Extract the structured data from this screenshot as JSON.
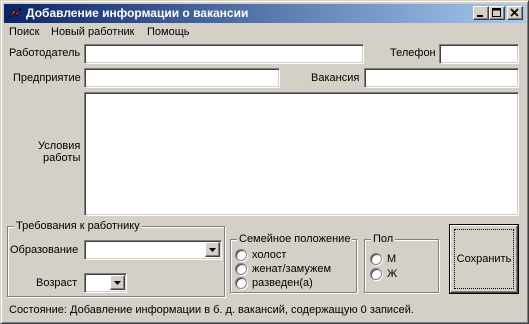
{
  "window": {
    "title": "Добавление информации о вакансии"
  },
  "menu": {
    "items": [
      "Поиск",
      "Новый работник",
      "Помощь"
    ]
  },
  "fields": {
    "employer_label": "Работодатель",
    "employer_value": "",
    "phone_label": "Телефон",
    "phone_value": "",
    "company_label": "Предприятие",
    "company_value": "",
    "vacancy_label": "Вакансия",
    "vacancy_value": "",
    "conditions_label_line1": "Условия",
    "conditions_label_line2": "работы",
    "conditions_value": ""
  },
  "requirements": {
    "title": "Требования к работнику",
    "education_label": "Образование",
    "education_value": "",
    "age_label": "Возраст",
    "age_value": ""
  },
  "marital": {
    "title": "Семейное положение",
    "options": [
      "холост",
      "женат/замужем",
      "разведен(а)"
    ]
  },
  "gender": {
    "title": "Пол",
    "options": [
      "М",
      "Ж"
    ]
  },
  "actions": {
    "save_label": "Сохранить"
  },
  "status": {
    "text": "Состояние: Добавление информации в б. д. вакансий, содержащую 0 записей."
  }
}
